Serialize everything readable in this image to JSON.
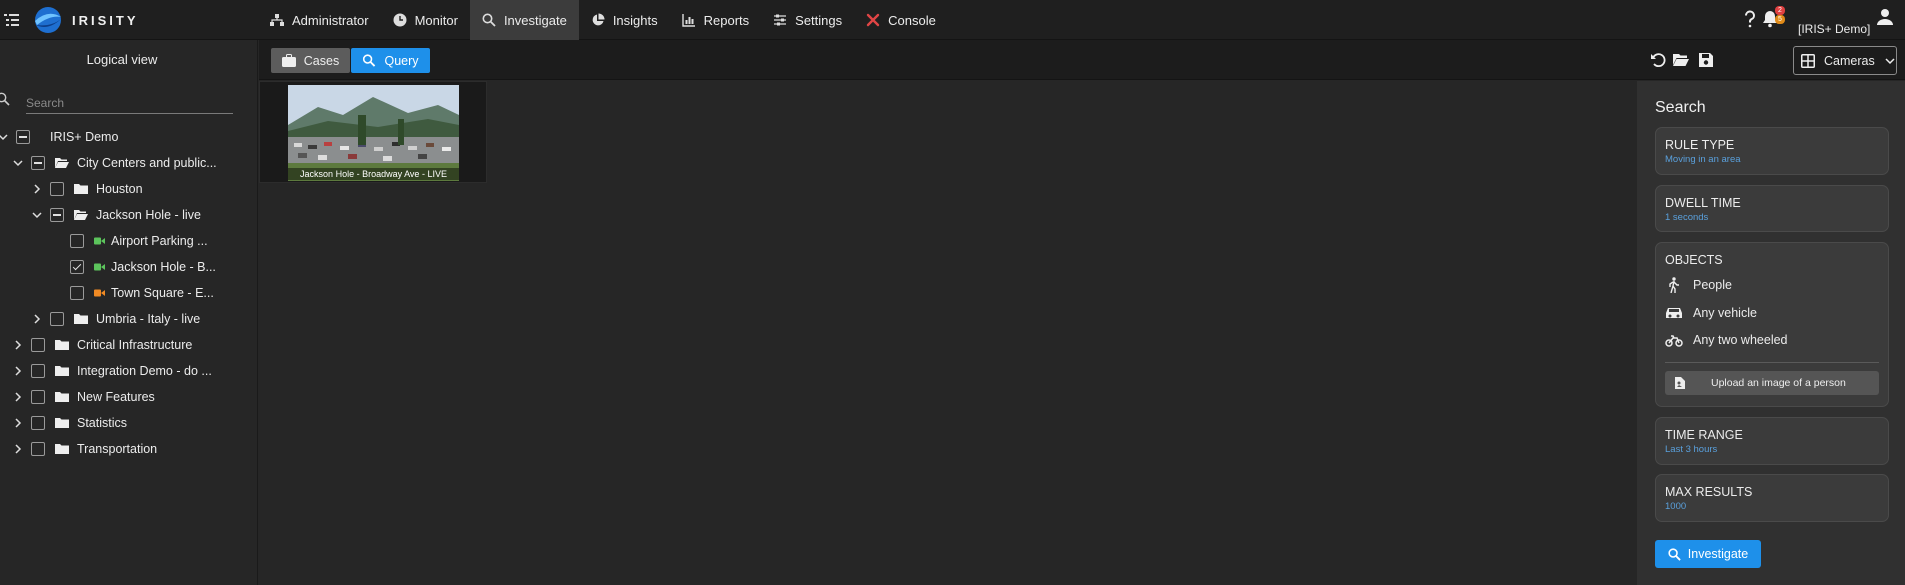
{
  "brand": {
    "name": "IRISITY"
  },
  "nav": {
    "items": [
      {
        "label": "Administrator",
        "icon": "sitemap-icon"
      },
      {
        "label": "Monitor",
        "icon": "clock-icon"
      },
      {
        "label": "Investigate",
        "icon": "search-icon",
        "active": true
      },
      {
        "label": "Insights",
        "icon": "pie-chart-icon"
      },
      {
        "label": "Reports",
        "icon": "bar-chart-icon"
      },
      {
        "label": "Settings",
        "icon": "sliders-icon"
      },
      {
        "label": "Console",
        "icon": "tools-icon"
      }
    ]
  },
  "header_right": {
    "help_icon": "question-icon",
    "notifications": {
      "red_count": "2",
      "orange_count": "5"
    },
    "user": "[IRIS+ Demo]"
  },
  "left_panel": {
    "title": "Logical view",
    "search_placeholder": "Search",
    "tree": [
      {
        "label": "IRIS+ Demo",
        "expanded": true,
        "state": "partial",
        "type": "root"
      },
      {
        "label": "City Centers and public...",
        "expanded": true,
        "state": "partial",
        "type": "folder-open"
      },
      {
        "label": "Houston",
        "expanded": false,
        "state": "unchecked",
        "type": "folder"
      },
      {
        "label": "Jackson Hole - live",
        "expanded": true,
        "state": "partial",
        "type": "folder-open"
      },
      {
        "label": "Airport Parking ...",
        "state": "unchecked",
        "type": "camera",
        "status_color": "#5cc45c"
      },
      {
        "label": "Jackson Hole - B...",
        "state": "checked",
        "type": "camera",
        "status_color": "#5cc45c"
      },
      {
        "label": "Town Square - E...",
        "state": "unchecked",
        "type": "camera",
        "status_color": "#f08a24"
      },
      {
        "label": "Umbria - Italy - live",
        "expanded": false,
        "state": "unchecked",
        "type": "folder"
      },
      {
        "label": "Critical Infrastructure",
        "expanded": false,
        "state": "unchecked",
        "type": "folder"
      },
      {
        "label": "Integration Demo - do ...",
        "expanded": false,
        "state": "unchecked",
        "type": "folder"
      },
      {
        "label": "New Features",
        "expanded": false,
        "state": "unchecked",
        "type": "folder"
      },
      {
        "label": "Statistics",
        "expanded": false,
        "state": "unchecked",
        "type": "folder"
      },
      {
        "label": "Transportation",
        "expanded": false,
        "state": "unchecked",
        "type": "folder"
      }
    ]
  },
  "toolbar": {
    "cases_label": "Cases",
    "query_label": "Query",
    "icons": [
      "undo-icon",
      "folder-open-icon",
      "save-icon"
    ],
    "view_select": "Cameras"
  },
  "results": [
    {
      "caption": "Jackson Hole - Broadway Ave - LIVE"
    }
  ],
  "search_panel": {
    "title": "Search",
    "rule_type": {
      "title": "RULE TYPE",
      "value": "Moving in an area"
    },
    "dwell_time": {
      "title": "DWELL TIME",
      "value": "1 seconds"
    },
    "objects": {
      "title": "OBJECTS",
      "items": [
        {
          "label": "People",
          "icon": "walking-person-icon"
        },
        {
          "label": "Any vehicle",
          "icon": "car-icon"
        },
        {
          "label": "Any two wheeled",
          "icon": "motorcycle-icon"
        }
      ],
      "upload_label": "Upload an image of a person"
    },
    "time_range": {
      "title": "TIME RANGE",
      "value": "Last 3 hours"
    },
    "max_results": {
      "title": "MAX RESULTS",
      "value": "1000"
    },
    "investigate_label": "Investigate"
  },
  "colors": {
    "accent": "#1e90ea",
    "value_text": "#5aa0dc",
    "online": "#5cc45c",
    "warning": "#f08a24"
  }
}
